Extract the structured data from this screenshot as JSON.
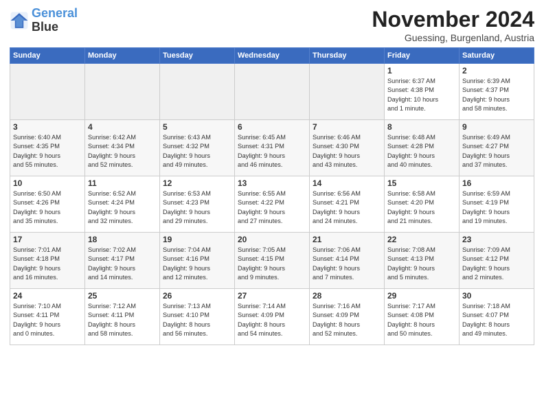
{
  "logo": {
    "line1": "General",
    "line2": "Blue"
  },
  "title": "November 2024",
  "location": "Guessing, Burgenland, Austria",
  "days_of_week": [
    "Sunday",
    "Monday",
    "Tuesday",
    "Wednesday",
    "Thursday",
    "Friday",
    "Saturday"
  ],
  "weeks": [
    [
      {
        "day": "",
        "info": "",
        "empty": true
      },
      {
        "day": "",
        "info": "",
        "empty": true
      },
      {
        "day": "",
        "info": "",
        "empty": true
      },
      {
        "day": "",
        "info": "",
        "empty": true
      },
      {
        "day": "",
        "info": "",
        "empty": true
      },
      {
        "day": "1",
        "info": "Sunrise: 6:37 AM\nSunset: 4:38 PM\nDaylight: 10 hours\nand 1 minute.",
        "empty": false
      },
      {
        "day": "2",
        "info": "Sunrise: 6:39 AM\nSunset: 4:37 PM\nDaylight: 9 hours\nand 58 minutes.",
        "empty": false
      }
    ],
    [
      {
        "day": "3",
        "info": "Sunrise: 6:40 AM\nSunset: 4:35 PM\nDaylight: 9 hours\nand 55 minutes.",
        "empty": false
      },
      {
        "day": "4",
        "info": "Sunrise: 6:42 AM\nSunset: 4:34 PM\nDaylight: 9 hours\nand 52 minutes.",
        "empty": false
      },
      {
        "day": "5",
        "info": "Sunrise: 6:43 AM\nSunset: 4:32 PM\nDaylight: 9 hours\nand 49 minutes.",
        "empty": false
      },
      {
        "day": "6",
        "info": "Sunrise: 6:45 AM\nSunset: 4:31 PM\nDaylight: 9 hours\nand 46 minutes.",
        "empty": false
      },
      {
        "day": "7",
        "info": "Sunrise: 6:46 AM\nSunset: 4:30 PM\nDaylight: 9 hours\nand 43 minutes.",
        "empty": false
      },
      {
        "day": "8",
        "info": "Sunrise: 6:48 AM\nSunset: 4:28 PM\nDaylight: 9 hours\nand 40 minutes.",
        "empty": false
      },
      {
        "day": "9",
        "info": "Sunrise: 6:49 AM\nSunset: 4:27 PM\nDaylight: 9 hours\nand 37 minutes.",
        "empty": false
      }
    ],
    [
      {
        "day": "10",
        "info": "Sunrise: 6:50 AM\nSunset: 4:26 PM\nDaylight: 9 hours\nand 35 minutes.",
        "empty": false
      },
      {
        "day": "11",
        "info": "Sunrise: 6:52 AM\nSunset: 4:24 PM\nDaylight: 9 hours\nand 32 minutes.",
        "empty": false
      },
      {
        "day": "12",
        "info": "Sunrise: 6:53 AM\nSunset: 4:23 PM\nDaylight: 9 hours\nand 29 minutes.",
        "empty": false
      },
      {
        "day": "13",
        "info": "Sunrise: 6:55 AM\nSunset: 4:22 PM\nDaylight: 9 hours\nand 27 minutes.",
        "empty": false
      },
      {
        "day": "14",
        "info": "Sunrise: 6:56 AM\nSunset: 4:21 PM\nDaylight: 9 hours\nand 24 minutes.",
        "empty": false
      },
      {
        "day": "15",
        "info": "Sunrise: 6:58 AM\nSunset: 4:20 PM\nDaylight: 9 hours\nand 21 minutes.",
        "empty": false
      },
      {
        "day": "16",
        "info": "Sunrise: 6:59 AM\nSunset: 4:19 PM\nDaylight: 9 hours\nand 19 minutes.",
        "empty": false
      }
    ],
    [
      {
        "day": "17",
        "info": "Sunrise: 7:01 AM\nSunset: 4:18 PM\nDaylight: 9 hours\nand 16 minutes.",
        "empty": false
      },
      {
        "day": "18",
        "info": "Sunrise: 7:02 AM\nSunset: 4:17 PM\nDaylight: 9 hours\nand 14 minutes.",
        "empty": false
      },
      {
        "day": "19",
        "info": "Sunrise: 7:04 AM\nSunset: 4:16 PM\nDaylight: 9 hours\nand 12 minutes.",
        "empty": false
      },
      {
        "day": "20",
        "info": "Sunrise: 7:05 AM\nSunset: 4:15 PM\nDaylight: 9 hours\nand 9 minutes.",
        "empty": false
      },
      {
        "day": "21",
        "info": "Sunrise: 7:06 AM\nSunset: 4:14 PM\nDaylight: 9 hours\nand 7 minutes.",
        "empty": false
      },
      {
        "day": "22",
        "info": "Sunrise: 7:08 AM\nSunset: 4:13 PM\nDaylight: 9 hours\nand 5 minutes.",
        "empty": false
      },
      {
        "day": "23",
        "info": "Sunrise: 7:09 AM\nSunset: 4:12 PM\nDaylight: 9 hours\nand 2 minutes.",
        "empty": false
      }
    ],
    [
      {
        "day": "24",
        "info": "Sunrise: 7:10 AM\nSunset: 4:11 PM\nDaylight: 9 hours\nand 0 minutes.",
        "empty": false
      },
      {
        "day": "25",
        "info": "Sunrise: 7:12 AM\nSunset: 4:11 PM\nDaylight: 8 hours\nand 58 minutes.",
        "empty": false
      },
      {
        "day": "26",
        "info": "Sunrise: 7:13 AM\nSunset: 4:10 PM\nDaylight: 8 hours\nand 56 minutes.",
        "empty": false
      },
      {
        "day": "27",
        "info": "Sunrise: 7:14 AM\nSunset: 4:09 PM\nDaylight: 8 hours\nand 54 minutes.",
        "empty": false
      },
      {
        "day": "28",
        "info": "Sunrise: 7:16 AM\nSunset: 4:09 PM\nDaylight: 8 hours\nand 52 minutes.",
        "empty": false
      },
      {
        "day": "29",
        "info": "Sunrise: 7:17 AM\nSunset: 4:08 PM\nDaylight: 8 hours\nand 50 minutes.",
        "empty": false
      },
      {
        "day": "30",
        "info": "Sunrise: 7:18 AM\nSunset: 4:07 PM\nDaylight: 8 hours\nand 49 minutes.",
        "empty": false
      }
    ]
  ]
}
